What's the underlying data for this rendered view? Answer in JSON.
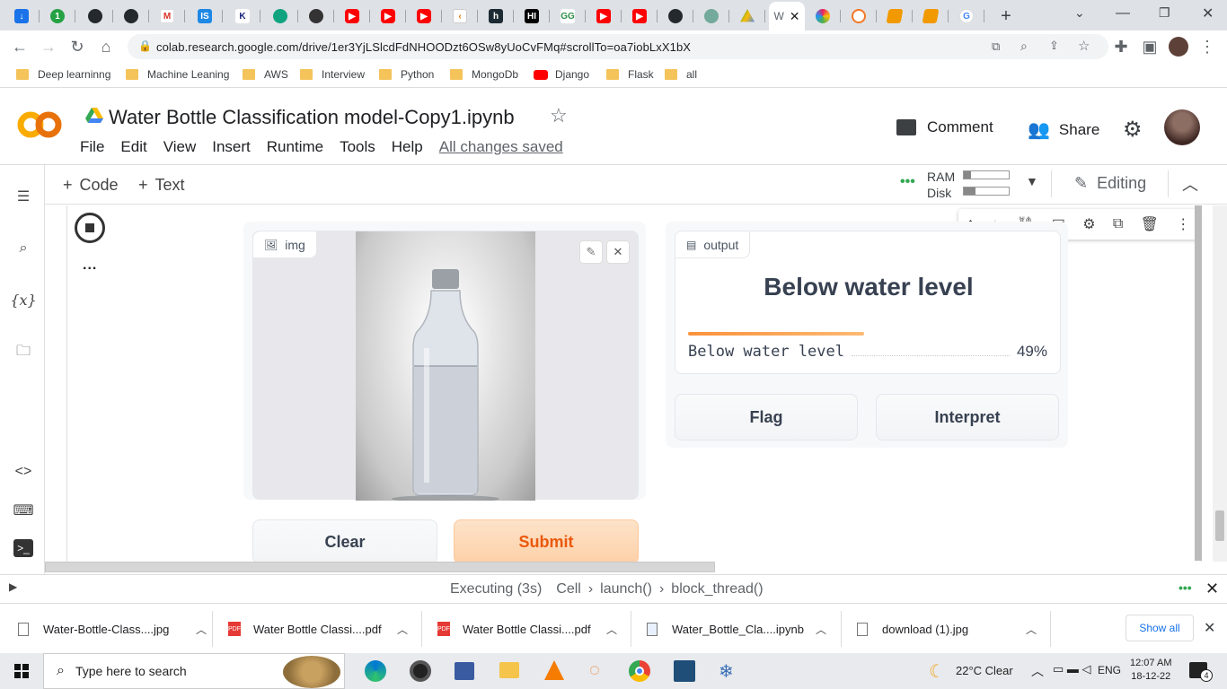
{
  "browser": {
    "url": "colab.research.google.com/drive/1er3YjLSlcdFdNHOODzt6OSw8yUoCvFMq#scrollTo=oa7iobLxX1bX",
    "active_tab_label": "W",
    "new_tab": "+"
  },
  "bookmarks": [
    {
      "label": "Deep learninng",
      "icon": "folder-icon"
    },
    {
      "label": "Machine Leaning",
      "icon": "folder-icon"
    },
    {
      "label": "AWS",
      "icon": "folder-icon"
    },
    {
      "label": "Interview",
      "icon": "folder-icon"
    },
    {
      "label": "Python",
      "icon": "folder-icon"
    },
    {
      "label": "MongoDb",
      "icon": "folder-icon"
    },
    {
      "label": "Django",
      "icon": "youtube-icon"
    },
    {
      "label": "Flask",
      "icon": "folder-icon"
    },
    {
      "label": "all",
      "icon": "folder-icon"
    }
  ],
  "colab": {
    "title": "Water Bottle Classification model-Copy1.ipynb",
    "menu": [
      "File",
      "Edit",
      "View",
      "Insert",
      "Runtime",
      "Tools",
      "Help"
    ],
    "saved_status": "All changes saved",
    "comment_label": "Comment",
    "share_label": "Share",
    "add_code": "Code",
    "add_text": "Text",
    "ram_label": "RAM",
    "disk_label": "Disk",
    "ram_fraction": 0.15,
    "disk_fraction": 0.25,
    "editing_label": "Editing",
    "cell_menu_dots": "..."
  },
  "gradio": {
    "input_label": "img",
    "output_label": "output",
    "prediction": "Below water level",
    "confidence_label": "Below water level",
    "confidence_value": "49%",
    "confidence_fraction": 0.49,
    "clear_label": "Clear",
    "submit_label": "Submit",
    "flag_label": "Flag",
    "interpret_label": "Interpret"
  },
  "statusbar": {
    "executing": "Executing (3s)",
    "crumbs": [
      "Cell",
      "launch()",
      "block_thread()"
    ]
  },
  "downloads": {
    "items": [
      {
        "name": "Water-Bottle-Class....jpg",
        "type": "image"
      },
      {
        "name": "Water Bottle Classi....pdf",
        "type": "pdf"
      },
      {
        "name": "Water Bottle Classi....pdf",
        "type": "pdf"
      },
      {
        "name": "Water_Bottle_Cla....ipynb",
        "type": "doc"
      },
      {
        "name": "download (1).jpg",
        "type": "image"
      }
    ],
    "show_all": "Show all"
  },
  "taskbar": {
    "search_placeholder": "Type here to search",
    "weather": "22°C  Clear",
    "lang": "ENG",
    "time": "12:07 AM",
    "date": "18-12-22",
    "notifications": "4"
  },
  "colors": {
    "colab_orange": "#f9ab00",
    "submit_bg": "#fdd6b0",
    "submit_text": "#ea580c",
    "bar_orange": "#fb923c"
  }
}
